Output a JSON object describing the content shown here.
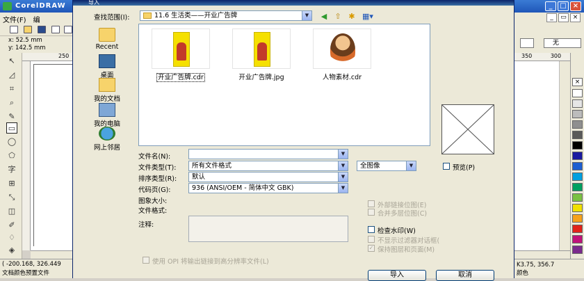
{
  "app": {
    "title": "CorelDRAW",
    "menu": [
      "文件(F)",
      "编"
    ],
    "prop_x": "x: 52.5 mm",
    "prop_y": "y: 142.5 mm",
    "ruler_left_tick": "250",
    "ruler_right_ticks": [
      "350",
      "300"
    ],
    "outline_value": "无",
    "status_coords": "( -200.168, 326.449",
    "status_profile": "文档颜色预置文件",
    "status_right_coords": "K3.75, 356.7",
    "status_right_text": "颜色"
  },
  "palette": [
    "#ffffff",
    "#e6e6e6",
    "#bcbcbc",
    "#8f8f8f",
    "#5a5a5a",
    "#000000",
    "#1a1aa0",
    "#1e5fd1",
    "#00a0e0",
    "#00a060",
    "#7ac142",
    "#f0e000",
    "#f7a21b",
    "#e2231a",
    "#c0127a",
    "#7b2a8c"
  ],
  "dialog": {
    "title": "导入",
    "look_in_label": "查找范围(I):",
    "look_in_value": "11.6 生活类——开业广告牌",
    "places": [
      "Recent",
      "桌面",
      "我的文档",
      "我的电脑",
      "网上邻居"
    ],
    "files": [
      {
        "name": "开业广告牌.cdr",
        "kind": "poster",
        "selected": true
      },
      {
        "name": "开业广告牌.jpg",
        "kind": "poster",
        "selected": false
      },
      {
        "name": "人物素材.cdr",
        "kind": "figure",
        "selected": false
      }
    ],
    "filename_label": "文件名(N):",
    "filename_value": "",
    "filetype_label": "文件类型(T):",
    "filetype_value": "所有文件格式",
    "sort_label": "排序类型(R):",
    "sort_value": "默认",
    "codepage_label": "代码页(G):",
    "codepage_value": "936 (ANSI/OEM - 简体中文 GBK)",
    "scope_value": "全图像",
    "preview_label": "预览(P)",
    "image_size_label": "图象大小:",
    "file_format_label": "文件格式:",
    "comment_label": "注释:",
    "options": [
      {
        "label": "外部链接位图(E)",
        "enabled": false,
        "checked": false
      },
      {
        "label": "合并多层位图(C)",
        "enabled": false,
        "checked": false
      },
      {
        "label": "检查水印(W)",
        "enabled": true,
        "checked": false
      },
      {
        "label": "不显示过滤器对话框(",
        "enabled": false,
        "checked": false
      },
      {
        "label": "保持图层和页面(M)",
        "enabled": false,
        "checked": true
      }
    ],
    "opi_label": "使用 OPI 将输出链接到高分辨率文件(L)",
    "import_button": "导入",
    "cancel_button": "取消"
  }
}
